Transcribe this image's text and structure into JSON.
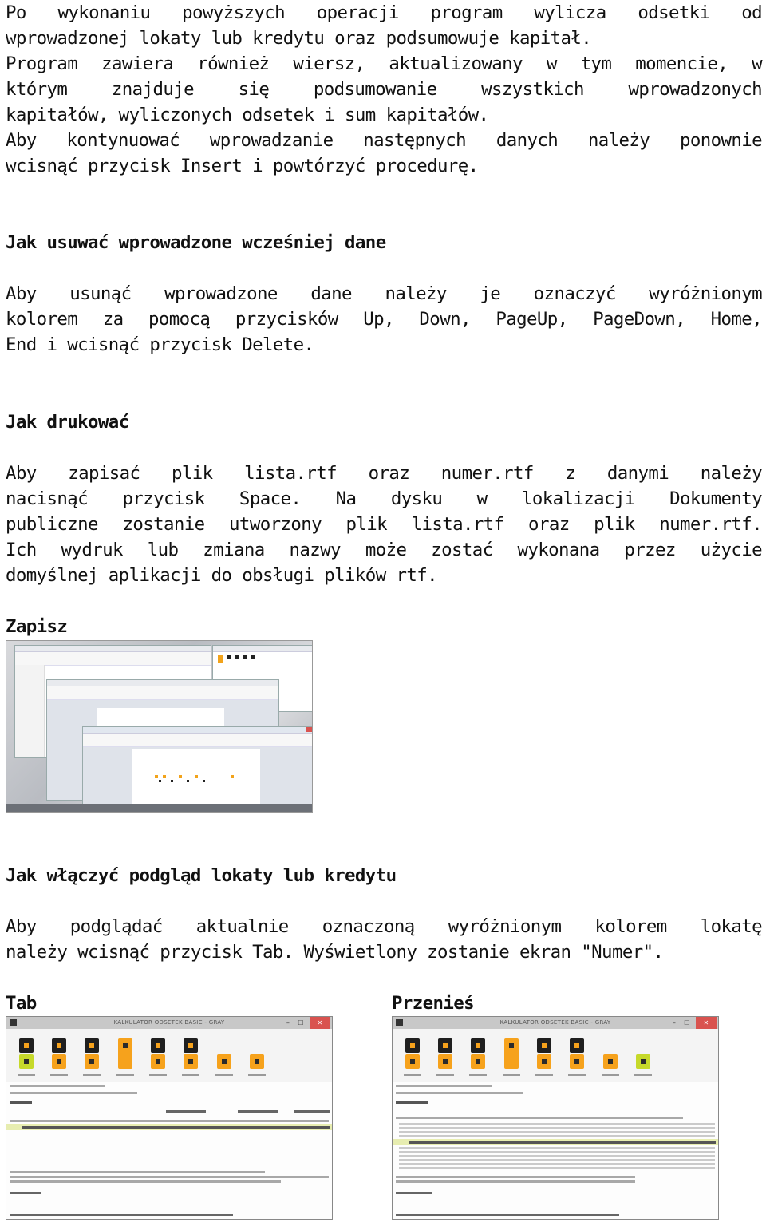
{
  "intro": {
    "lines": [
      "Po wykonaniu powyższych operacji program wylicza odsetki od",
      "wprowadzonej lokaty lub kredytu oraz podsumowuje kapitał.",
      "Program zawiera również wiersz, aktualizowany w tym momencie, w",
      "którym znajduje się podsumowanie wszystkich wprowadzonych",
      "kapitałów, wyliczonych odsetek i sum kapitałów.",
      "Aby kontynuować wprowadzanie następnych danych należy ponownie",
      "wcisnąć przycisk Insert i powtórzyć procedurę."
    ]
  },
  "sections": {
    "delete": {
      "heading": "Jak usuwać wprowadzone wcześniej dane",
      "lines": [
        "Aby usunąć wprowadzone dane należy je oznaczyć wyróżnionym",
        "kolorem za pomocą przycisków Up, Down, PageUp, PageDown, Home,",
        "End i wcisnąć przycisk Delete."
      ]
    },
    "print": {
      "heading": "Jak drukować",
      "lines": [
        "Aby zapisać plik lista.rtf oraz numer.rtf z danymi należy",
        "nacisnąć przycisk Space. Na dysku w lokalizacji Dokumenty",
        "publiczne zostanie utworzony plik lista.rtf oraz plik numer.rtf.",
        "Ich wydruk lub zmiana nazwy może zostać wykonana przez użycie",
        "domyślnej aplikacji do obsługi plików rtf."
      ],
      "figure_label": "Zapisz"
    },
    "preview": {
      "heading": "Jak włączyć podgląd lokaty lub kredytu",
      "lines": [
        "Aby podglądać aktualnie oznaczoną wyróżnionym kolorem lokatę",
        "należy wcisnąć przycisk Tab. Wyświetlony zostanie ekran \"Numer\"."
      ],
      "figures": [
        {
          "label": "Tab",
          "window_title": "KALKULATOR ODSETEK BASIC - GRAY"
        },
        {
          "label": "Przenieś",
          "window_title": "KALKULATOR ODSETEK BASIC - GRAY"
        }
      ]
    }
  },
  "icons": {
    "close": "✕",
    "maximize": "☐",
    "minimize": "–"
  },
  "colors": {
    "toolbar_orange": "#f6a21c",
    "toolbar_lime": "#c6d92a",
    "highlight_row": "#e7edb0",
    "close_red": "#d9534f"
  }
}
